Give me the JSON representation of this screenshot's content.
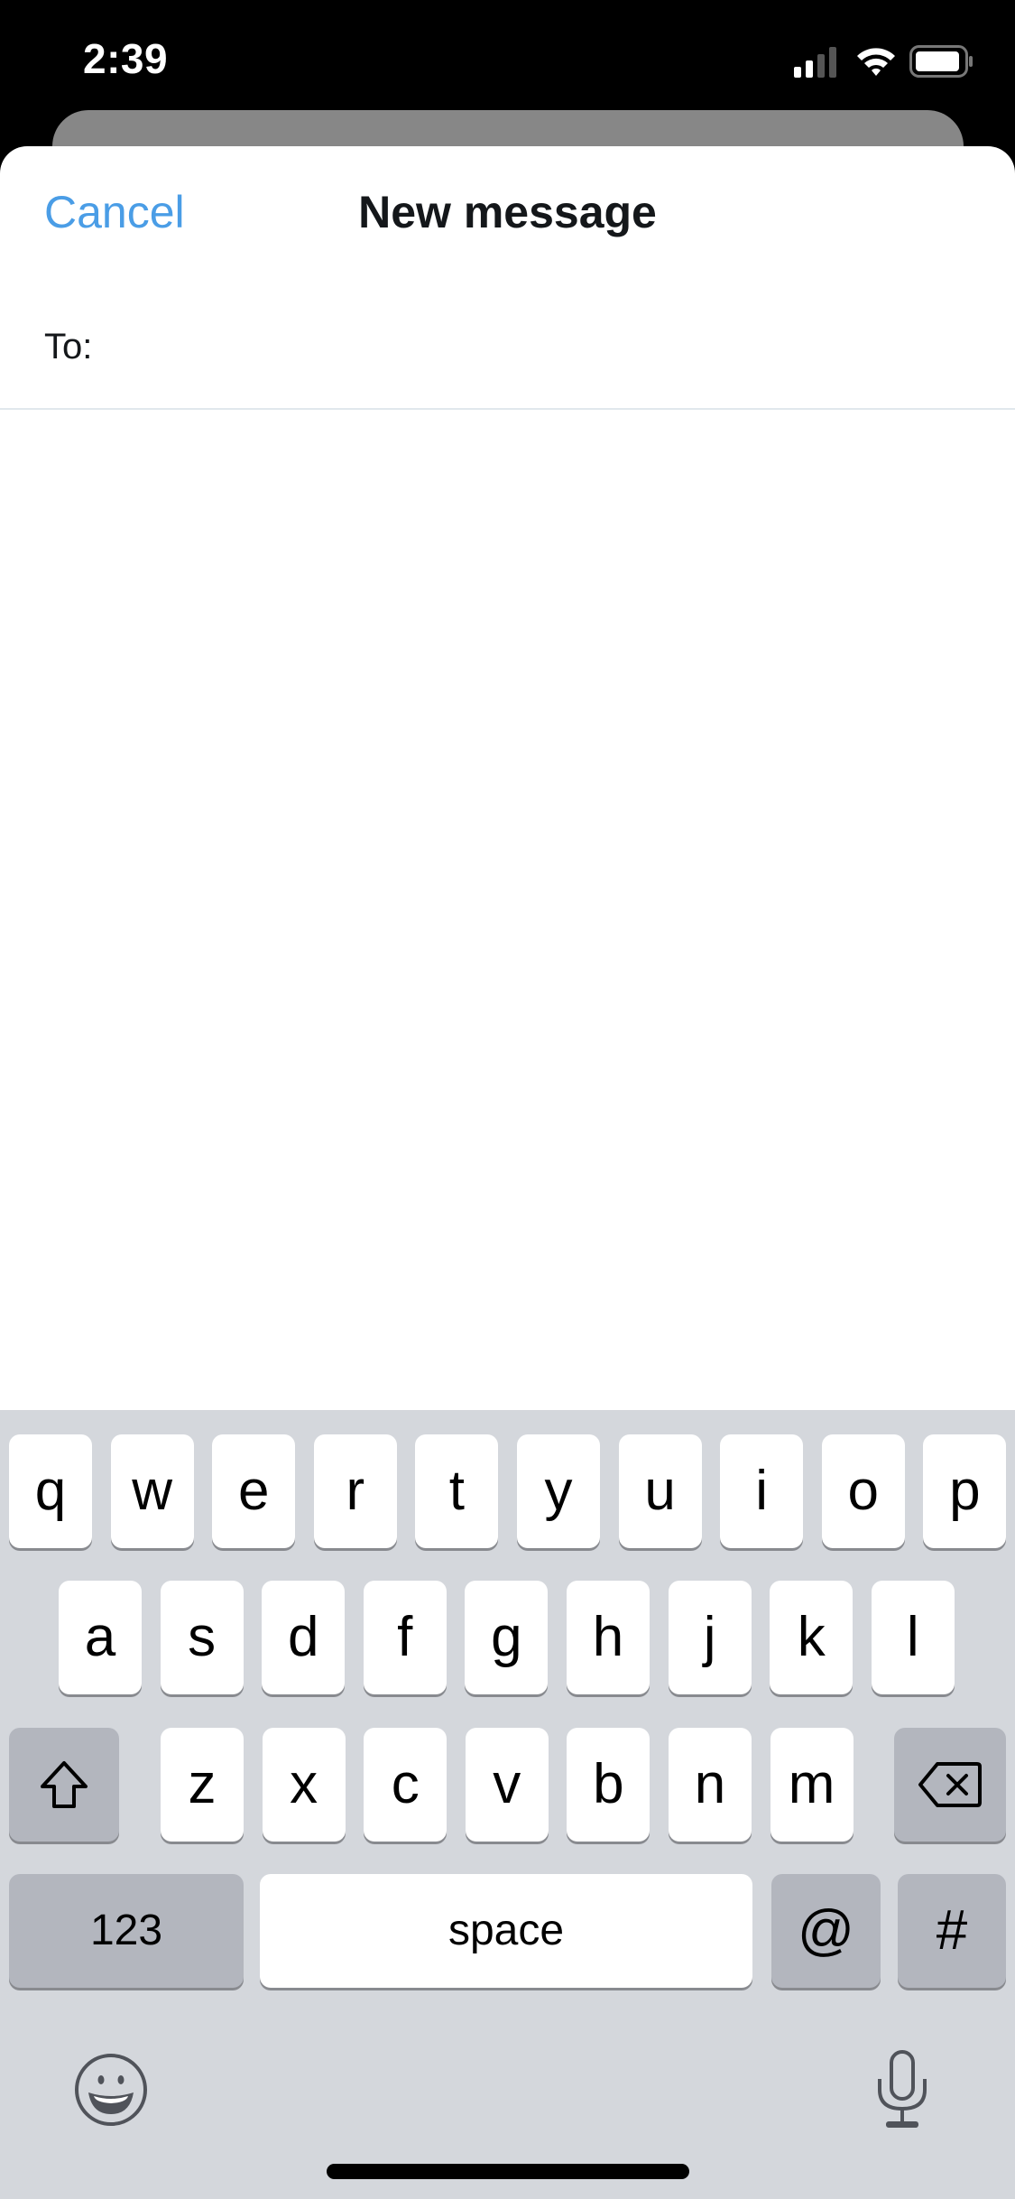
{
  "status_bar": {
    "time": "2:39",
    "icons": [
      "cellular-signal-icon",
      "wifi-icon",
      "battery-icon"
    ]
  },
  "header": {
    "cancel_label": "Cancel",
    "title": "New message"
  },
  "compose": {
    "to_label": "To:",
    "to_value": "",
    "to_placeholder": ""
  },
  "keyboard": {
    "row1": [
      "q",
      "w",
      "e",
      "r",
      "t",
      "y",
      "u",
      "i",
      "o",
      "p"
    ],
    "row2": [
      "a",
      "s",
      "d",
      "f",
      "g",
      "h",
      "j",
      "k",
      "l"
    ],
    "row3": [
      "z",
      "x",
      "c",
      "v",
      "b",
      "n",
      "m"
    ],
    "numbers_label": "123",
    "space_label": "space",
    "at_label": "@",
    "hash_label": "#",
    "icons": [
      "shift-icon",
      "backspace-icon",
      "emoji-icon",
      "microphone-icon"
    ]
  },
  "colors": {
    "accent": "#4a9de6",
    "title": "#14171a",
    "keyboard_bg": "#d4d7dc",
    "dark_key": "#b3b6be"
  }
}
